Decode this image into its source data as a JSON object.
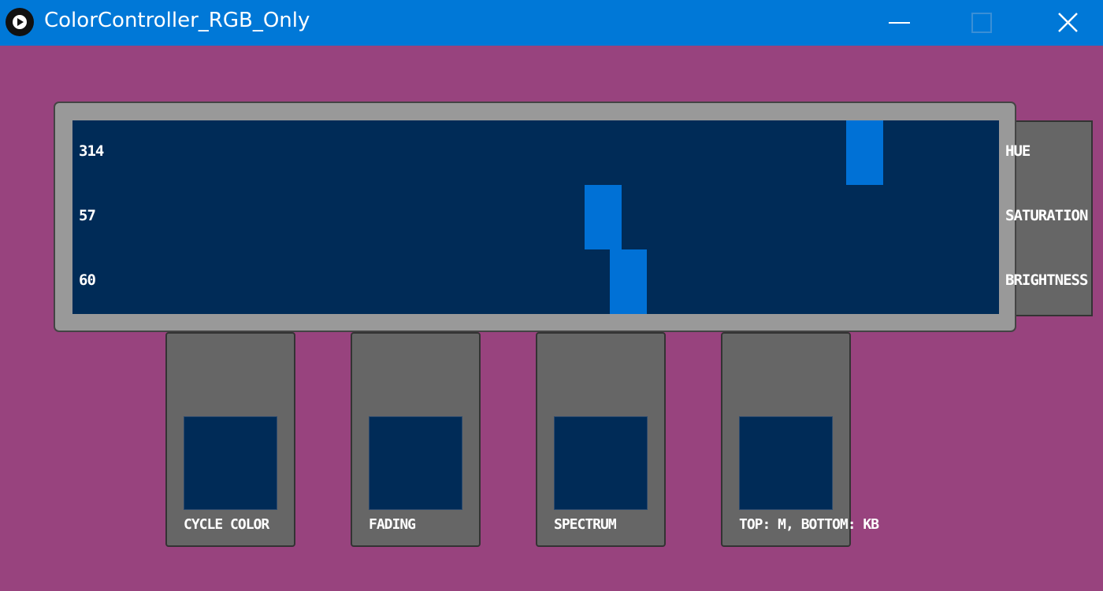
{
  "window": {
    "title": "ColorController_RGB_Only"
  },
  "display": {
    "rows": [
      {
        "value": "314",
        "label": "HUE",
        "level": 0.855
      },
      {
        "value": "57",
        "label": "SATURATION",
        "level": 0.573
      },
      {
        "value": "60",
        "label": "BRIGHTNESS",
        "level": 0.6
      }
    ]
  },
  "modes": [
    {
      "label": "CYCLE COLOR"
    },
    {
      "label": "FADING"
    },
    {
      "label": "SPECTRUM"
    },
    {
      "label": "TOP: M, BOTTOM: KB"
    }
  ],
  "colors": {
    "background": "#98437e",
    "titlebar": "#0078d7",
    "display": "#002b57",
    "indicator": "#0071d6",
    "panel": "#999999",
    "button": "#666666"
  },
  "icons": {
    "app": "play-circle-icon",
    "minimize": "minimize-icon",
    "maximize": "maximize-icon",
    "close": "close-icon"
  }
}
